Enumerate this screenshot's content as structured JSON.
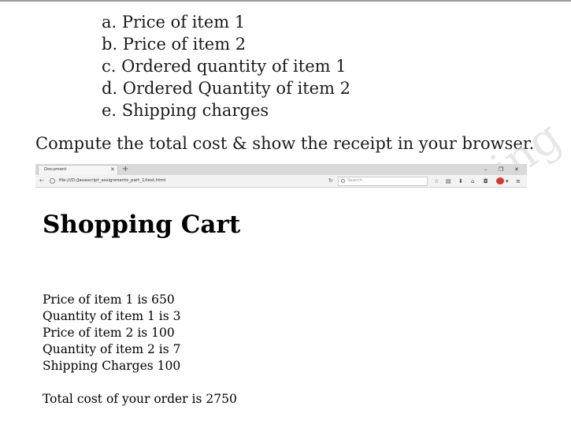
{
  "requirements": [
    "a. Price of item 1",
    "b. Price of item 2",
    "c. Ordered quantity of item 1",
    "d. Ordered Quantity of item 2",
    "e. Shipping charges"
  ],
  "instruction": "Compute the total cost & show the receipt in your browser.",
  "watermark": "ing",
  "browser": {
    "tab_title": "Document",
    "url": "file:///D:/Javascript_assignments_part_1/test.html",
    "search_placeholder": "Search",
    "abp_color": "#d9342b"
  },
  "page": {
    "heading": "Shopping Cart",
    "receipt_lines": [
      "Price of item 1 is 650",
      "Quantity of item 1 is 3",
      "Price of item 2 is 100",
      "Quantity of item 2 is 7",
      "Shipping Charges 100"
    ],
    "total": "Total cost of your order is 2750"
  }
}
